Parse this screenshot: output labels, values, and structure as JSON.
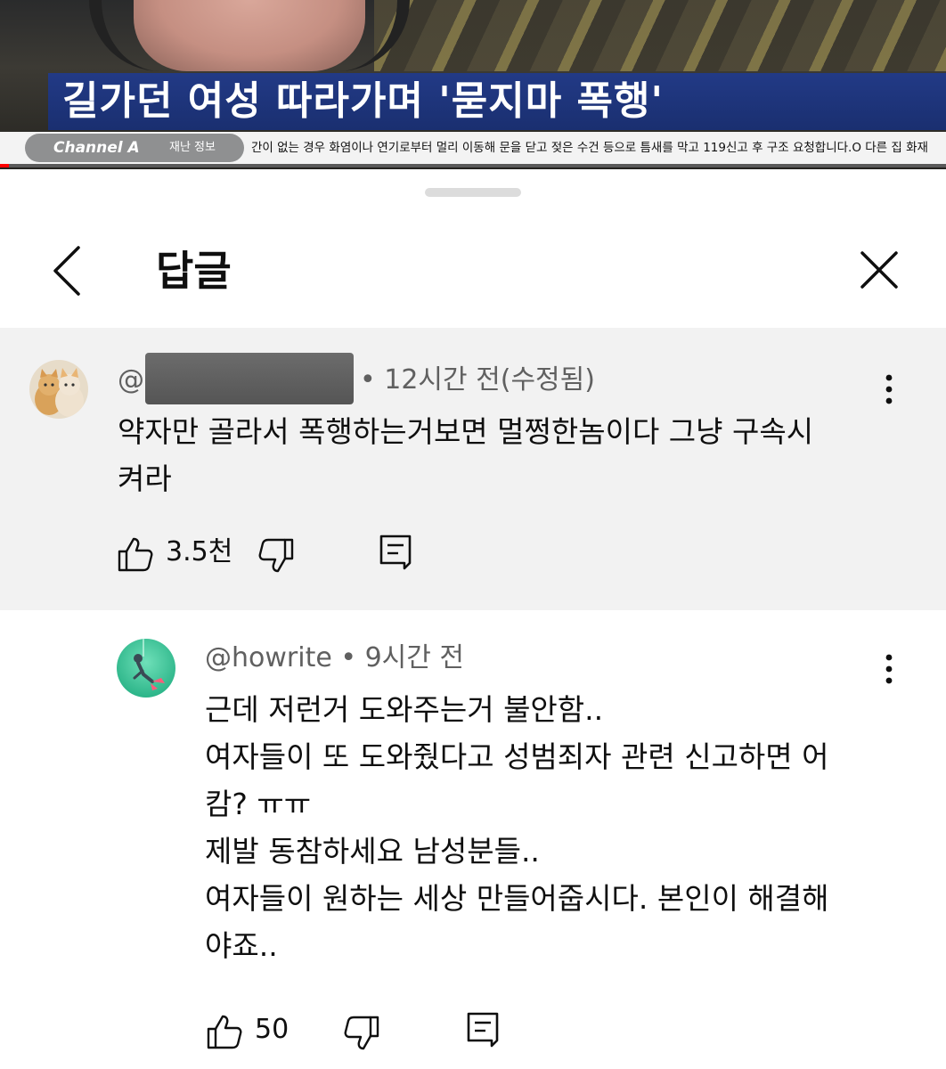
{
  "video": {
    "headline": "길가던 여성 따라가며 '묻지마 폭행'",
    "channel": "Channel A",
    "ticker_label": "재난 정보",
    "ticker_text": "간이 없는 경우 화염이나 연기로부터 멀리 이동해 문을 닫고 젖은 수건 등으로 틈새를 막고 119신고 후 구조 요청합니다.O 다른 집 화재"
  },
  "sheet": {
    "title": "답글",
    "back_icon": "chevron-left-icon",
    "close_icon": "close-icon"
  },
  "parent_comment": {
    "author": "@",
    "author_redacted": true,
    "meta": "• 12시간 전(수정됨)",
    "body_lines": [
      "약자만 골라서 폭행하는거보면 멀쩡한놈이다 그냥 구속시",
      "켜라"
    ],
    "like_count": "3.5천",
    "highlight_color": "#f2f2f2"
  },
  "reply": {
    "author": "@howrite",
    "meta": "• 9시간 전",
    "body_lines": [
      "근데 저런거 도와주는거 불안함..",
      "여자들이 또 도와줬다고 성범죄자 관련 신고하면 어",
      "캄? ㅠㅠ",
      "제발 동참하세요 남성분들..",
      "여자들이 원하는 세상 만들어줍시다. 본인이 해결해",
      "야죠.."
    ],
    "like_count": "50"
  }
}
